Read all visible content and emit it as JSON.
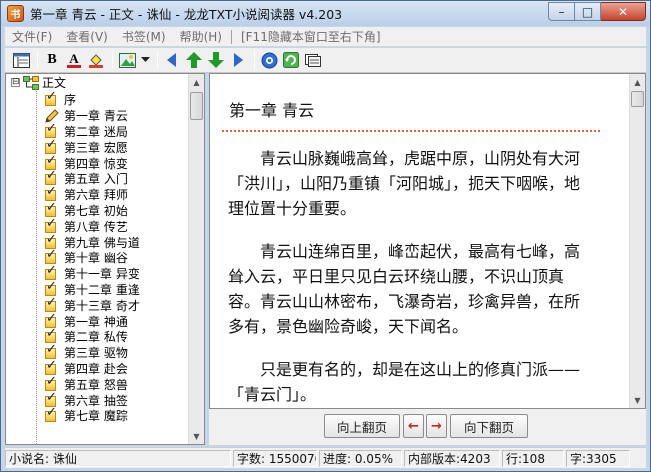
{
  "window": {
    "title": "第一章 青云 - 正文 - 诛仙 - 龙龙TXT小说阅读器 v4.203",
    "app_icon": "book-icon",
    "buttons": {
      "minimize": "–",
      "maximize": "□",
      "close": "✕"
    }
  },
  "menu": {
    "items": [
      {
        "label": "文件(F)"
      },
      {
        "label": "查看(V)"
      },
      {
        "label": "书签(M)"
      },
      {
        "label": "帮助(H)"
      }
    ],
    "hint": "[F11隐藏本窗口至右下角]"
  },
  "toolbar": {
    "icons": [
      "toc-grid-icon",
      "bold-icon",
      "font-color-icon",
      "fill-color-icon",
      "image-icon",
      "dropdown-arrow-icon",
      "prev-icon",
      "up-arrow-icon",
      "down-arrow-icon",
      "next-icon",
      "info-globe-icon",
      "refresh-icon",
      "library-icon"
    ],
    "bold_label": "B",
    "font_color_label": "A"
  },
  "tree": {
    "root_label": "正文",
    "expander": "⊟",
    "items": [
      {
        "label": "序"
      },
      {
        "label": "第一章 青云"
      },
      {
        "label": "第二章 迷局"
      },
      {
        "label": "第三章 宏愿"
      },
      {
        "label": "第四章 惊变"
      },
      {
        "label": "第五章 入门"
      },
      {
        "label": "第六章 拜师"
      },
      {
        "label": "第七章 初始"
      },
      {
        "label": "第八章 传艺"
      },
      {
        "label": "第九章 佛与道"
      },
      {
        "label": "第十章 幽谷"
      },
      {
        "label": "第十一章 异变"
      },
      {
        "label": "第十二章 重逢"
      },
      {
        "label": "第十三章 奇才"
      },
      {
        "label": "第一章 神通"
      },
      {
        "label": "第二章 私传"
      },
      {
        "label": "第三章 驱物"
      },
      {
        "label": "第四章 赴会"
      },
      {
        "label": "第五章 怒兽"
      },
      {
        "label": "第六章 抽签"
      },
      {
        "label": "第七章 魔踪"
      }
    ],
    "current_index": 1
  },
  "reader": {
    "chapter_title": "第一章 青云",
    "paragraphs": [
      "　　青云山脉巍峨高耸，虎踞中原，山阴处有大河「洪川」，山阳乃重镇「河阳城」，扼天下咽喉，地理位置十分重要。",
      "　　青云山连绵百里，峰峦起伏，最高有七峰，高耸入云，平日里只见白云环绕山腰，不识山顶真容。青云山山林密布，飞瀑奇岩，珍禽异兽，在所多有，景色幽险奇峻，天下闻名。",
      "　　只是更有名的，却是在这山上的修真门派——「青云门」。"
    ]
  },
  "pagenav": {
    "prev_page": "向上翻页",
    "left_arrow": "←",
    "right_arrow": "→",
    "next_page": "向下翻页"
  },
  "status": {
    "novel_name": "小说名: 诛仙",
    "word_count": "字数: 1550070",
    "progress": "进度: 0.05%",
    "internal_version": "内部版本:4203",
    "line": "行:108",
    "chars": "字:3305"
  },
  "colors": {
    "title_bar": "#c4d6ea",
    "divider_dots": "#e0633a",
    "nav_arrow": "#c0281b",
    "toolbar_green": "#1f9a2a",
    "toolbar_blue": "#2c68c9"
  }
}
